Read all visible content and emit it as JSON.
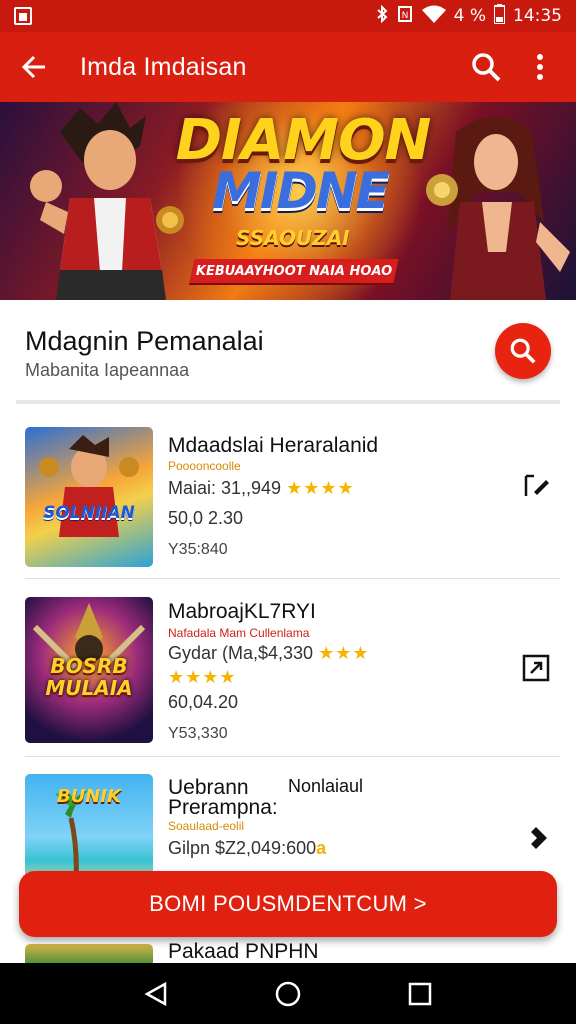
{
  "status_bar": {
    "battery_text": "4 %",
    "time": "14:35",
    "icons": [
      "app-notification-icon",
      "bluetooth-icon",
      "vibrate-icon",
      "wifi-icon",
      "battery-icon"
    ]
  },
  "app_bar": {
    "title": "Imda Imdaisan",
    "icons": [
      "back-arrow-icon",
      "search-icon",
      "more-vert-icon"
    ]
  },
  "banner": {
    "title_line1": "DIAMON",
    "title_line2": "MIDNE",
    "subtitle": "SSAOUZAI",
    "ribbon": "KEBUAAYHOOT NAIA HOAO"
  },
  "section": {
    "title": "Mdagnin Pemanalai",
    "subtitle": "Mabanita Iapeannaa"
  },
  "items": [
    {
      "name": "Mdaadslai Heraralanid",
      "tag": "Pooooncoolle",
      "meta": "Maiai: 31,,949",
      "stars": "★★★★",
      "line1": "50,0 2.30",
      "line2": "Y35:840",
      "thumb_text": "SOLNIIAN"
    },
    {
      "name": "MabroajKL7RYI",
      "tag": "Nafadala Mam Cullenlama",
      "meta": "Gydar (Ma,$4,330",
      "stars": "★★★",
      "stars2": "★★★★",
      "line1": "60,04.20",
      "line2": "Y53,330",
      "thumb_text": "BOSRB MULAIA"
    },
    {
      "name": "Uebrann",
      "name_right": "Nonlaiaul",
      "name2": "Prerampna:",
      "tag": "Soaulaad-eolil",
      "meta": "Gilpn $Z2,049:600",
      "meta_suffix": "a",
      "thumb_text": "BUNIK"
    },
    {
      "name": "Pakaad PNPHN"
    }
  ],
  "cta": {
    "label": "BOMI POUSMDENTCUM >"
  },
  "nav": {
    "icons": [
      "back-triangle-icon",
      "home-circle-icon",
      "recents-square-icon"
    ]
  },
  "colors": {
    "primary": "#d91f10",
    "status": "#c8190f",
    "star": "#f4b400"
  }
}
